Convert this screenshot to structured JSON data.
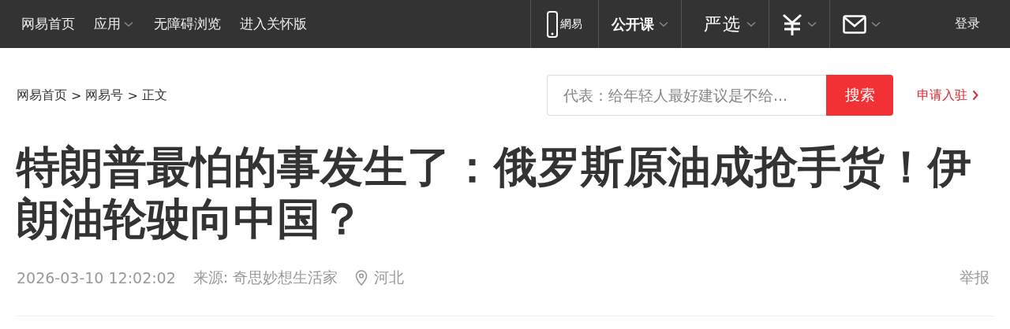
{
  "top_nav": {
    "left_items": [
      {
        "label": "网易首页",
        "has_caret": false
      },
      {
        "label": "应用",
        "has_caret": true
      },
      {
        "label": "无障碍浏览",
        "has_caret": false
      },
      {
        "label": "进入关怀版",
        "has_caret": false
      }
    ],
    "right_items": [
      {
        "kind": "phone",
        "label": "網易",
        "has_caret": false
      },
      {
        "kind": "text",
        "label": "公开课",
        "has_caret": true
      },
      {
        "kind": "logo",
        "label": "严选",
        "has_caret": true
      },
      {
        "kind": "yen",
        "has_caret": true
      },
      {
        "kind": "mail",
        "has_caret": true
      }
    ],
    "login": "登录"
  },
  "breadcrumb": [
    "网易首页",
    "网易号",
    "正文"
  ],
  "breadcrumb_separator": ">",
  "search": {
    "placeholder": "代表：给年轻人最好建议是不给...",
    "button": "搜索"
  },
  "apply_link": "申请入驻",
  "article": {
    "title": "特朗普最怕的事发生了：俄罗斯原油成抢手货！伊朗油轮驶向中国？",
    "datetime": "2026-03-10 12:02:02",
    "source": "来源: 奇思妙想生活家",
    "location": "河北",
    "report": "举报"
  }
}
